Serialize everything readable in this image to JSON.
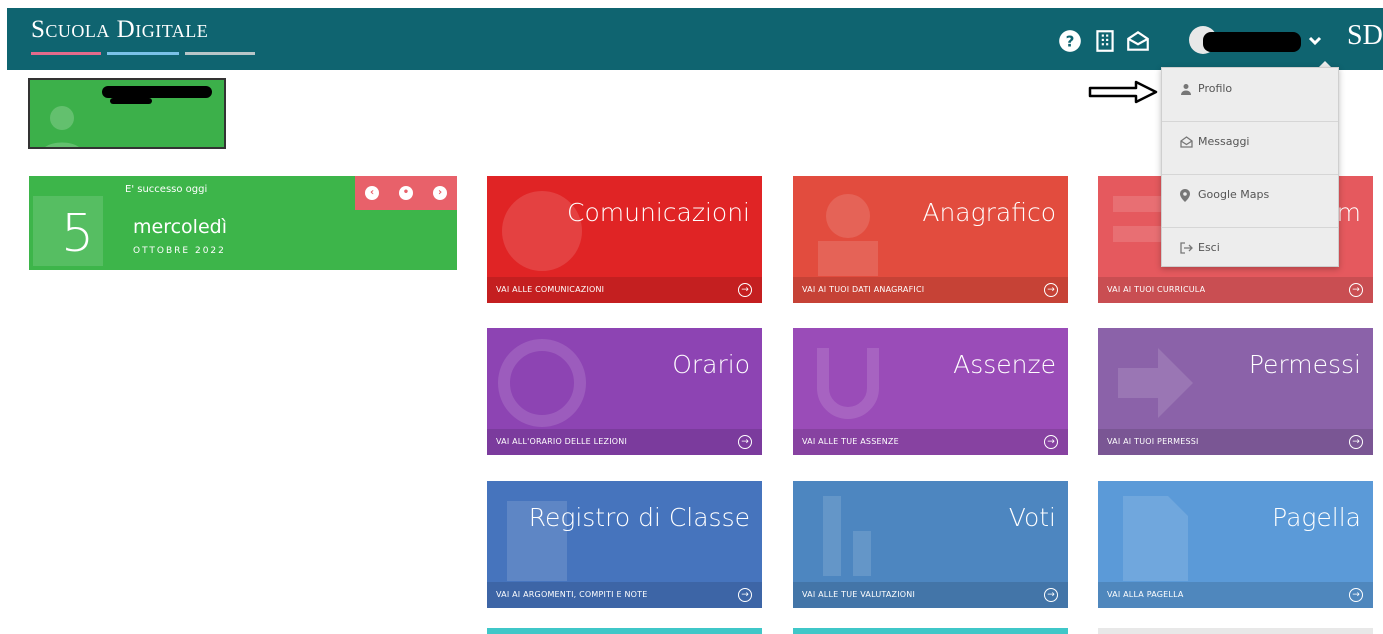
{
  "header": {
    "brand": "Scuola Digitale",
    "brand_short": "SD",
    "icons": [
      "help-icon",
      "building-icon",
      "mail-icon",
      "user-avatar",
      "chevron-down-icon"
    ]
  },
  "user_menu": {
    "items": [
      {
        "label": "Profilo",
        "icon": "user-icon"
      },
      {
        "label": "Messaggi",
        "icon": "envelope-icon"
      },
      {
        "label": "Google Maps",
        "icon": "map-marker-icon"
      },
      {
        "label": "Esci",
        "icon": "sign-out-icon"
      }
    ]
  },
  "date_widget": {
    "happened_label": "E' successo oggi",
    "day_number": "5",
    "day_name": "mercoledì",
    "month_year": "OTTOBRE 2022",
    "nav": [
      "‹",
      "•",
      "›"
    ]
  },
  "tiles": [
    {
      "title": "Comunicazioni",
      "link": "VAI ALLE COMUNICAZIONI",
      "color": "#e02425"
    },
    {
      "title": "Anagrafico",
      "link": "VAI AI TUOI DATI ANAGRAFICI",
      "color": "#e24c3e"
    },
    {
      "title": "m",
      "link": "VAI AI TUOI CURRICULA",
      "color": "#e5595e"
    },
    {
      "title": "Orario",
      "link": "VAI ALL'ORARIO DELLE LEZIONI",
      "color": "#8d44b3"
    },
    {
      "title": "Assenze",
      "link": "VAI ALLE TUE ASSENZE",
      "color": "#9a4cb8"
    },
    {
      "title": "Permessi",
      "link": "VAI AI TUOI PERMESSI",
      "color": "#8b62a9"
    },
    {
      "title": "Registro di Classe",
      "link": "VAI AI ARGOMENTI, COMPITI E NOTE",
      "color": "#4674bd"
    },
    {
      "title": "Voti",
      "link": "VAI ALLE TUE VALUTAZIONI",
      "color": "#4d86c0"
    },
    {
      "title": "Pagella",
      "link": "VAI ALLA PAGELLA",
      "color": "#5b9ad8"
    }
  ],
  "colors": {
    "topbar": "#0f6470",
    "green": "#3db54a",
    "date_nav": "#e8616a"
  }
}
